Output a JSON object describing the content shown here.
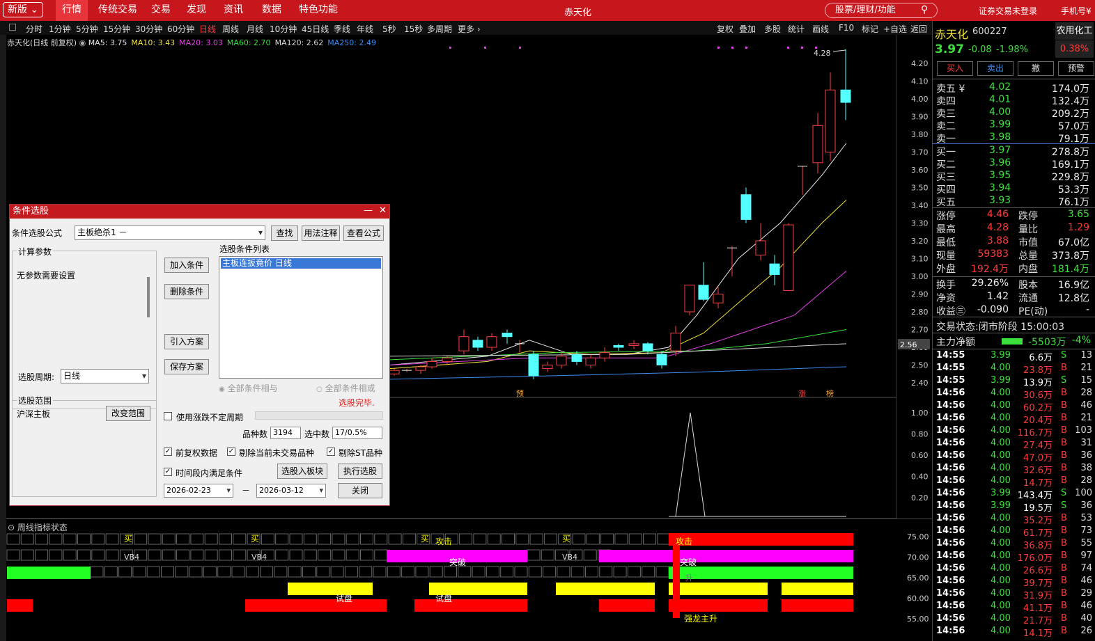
{
  "topbar": {
    "version": "新版",
    "nav": [
      "行情",
      "传统交易",
      "交易",
      "发现",
      "资讯",
      "数据",
      "特色功能"
    ],
    "active": 0,
    "app_title": "赤天化",
    "search_placeholder": "股票/理财/功能",
    "right_links": [
      "证券交易未登录",
      "手机号¥"
    ]
  },
  "timeframes": {
    "items": [
      "分时",
      "1分钟",
      "5分钟",
      "15分钟",
      "30分钟",
      "60分钟",
      "日线",
      "周线",
      "月线",
      "10分钟",
      "45日线",
      "季线",
      "年线",
      "5秒",
      "15秒",
      "多周期",
      "更多"
    ],
    "active": 6
  },
  "tools": [
    "复权",
    "叠加",
    "多股",
    "统计",
    "画线",
    "F10",
    "标记",
    "+自选",
    "返回"
  ],
  "ma_bar": {
    "title": "赤天化(日线 前复权)",
    "items": [
      {
        "label": "MA5: 3.75",
        "color": "#e8e8e8"
      },
      {
        "label": "MA10: 3.43",
        "color": "#f2e33b"
      },
      {
        "label": "MA20: 3.03",
        "color": "#e040e0"
      },
      {
        "label": "MA60: 2.70",
        "color": "#3ce03c"
      },
      {
        "label": "MA120: 2.62",
        "color": "#d8d8d8"
      },
      {
        "label": "MA250: 2.49",
        "color": "#3c8cf0"
      }
    ]
  },
  "price_axis": [
    "4.20",
    "4.10",
    "4.00",
    "3.90",
    "3.80",
    "3.70",
    "3.60",
    "3.50",
    "3.40",
    "3.30",
    "3.20",
    "3.10",
    "3.00",
    "2.90",
    "2.80",
    "2.70",
    "2.60",
    "2.50",
    "2.40"
  ],
  "price_label": "2.56",
  "high_label": "4.28",
  "markers": {
    "yu": "预",
    "zhang": "涨",
    "bang": "榜"
  },
  "indicator_axis": [
    "1.00",
    "0.80",
    "0.60",
    "0.40",
    "0.20"
  ],
  "bottom_axis": [
    "75.00",
    "70.00",
    "65.00",
    "60.00",
    "55.00"
  ],
  "bottom_title": "周线指标状态",
  "bottom_labels": {
    "buy": "买",
    "attack": "攻击",
    "vb4": "VB4",
    "breakout": "突破",
    "test": "试盘",
    "rise": "升",
    "dragon": "强龙主升",
    "attack2": "攻击",
    "breakout2": "突破",
    "test2": "试盘"
  },
  "quote": {
    "name": "赤天化",
    "code": "600227",
    "price": "3.97",
    "change": "-0.08",
    "pct": "-1.98%",
    "related": "农用化工",
    "related_pct": "0.38%",
    "buttons": [
      "买入",
      "卖出",
      "撤",
      "预警"
    ]
  },
  "asks": [
    {
      "label": "卖五",
      "price": "4.02",
      "vol": "174.0万",
      "yen": "¥"
    },
    {
      "label": "卖四",
      "price": "4.01",
      "vol": "132.4万"
    },
    {
      "label": "卖三",
      "price": "4.00",
      "vol": "209.2万"
    },
    {
      "label": "卖二",
      "price": "3.99",
      "vol": "57.0万"
    },
    {
      "label": "卖一",
      "price": "3.98",
      "vol": "79.1万"
    }
  ],
  "bids": [
    {
      "label": "买一",
      "price": "3.97",
      "vol": "278.8万"
    },
    {
      "label": "买二",
      "price": "3.96",
      "vol": "169.1万"
    },
    {
      "label": "买三",
      "price": "3.95",
      "vol": "229.8万"
    },
    {
      "label": "买四",
      "price": "3.94",
      "vol": "53.3万"
    },
    {
      "label": "买五",
      "price": "3.93",
      "vol": "76.1万"
    }
  ],
  "stats": [
    {
      "l1": "涨停",
      "v1": "4.46",
      "c1": "#ff3b3b",
      "l2": "跌停",
      "v2": "3.65",
      "c2": "#3ce03c"
    },
    {
      "l1": "最高",
      "v1": "4.28",
      "c1": "#ff3b3b",
      "l2": "量比",
      "v2": "1.29",
      "c2": "#ff3b3b"
    },
    {
      "l1": "最低",
      "v1": "3.88",
      "c1": "#ff3b3b",
      "l2": "市值",
      "v2": "67.0亿",
      "c2": "#eee"
    },
    {
      "l1": "现量",
      "v1": "59383",
      "c1": "#ff3b3b",
      "l2": "总量",
      "v2": "373.8万",
      "c2": "#eee"
    },
    {
      "l1": "外盘",
      "v1": "192.4万",
      "c1": "#ff3b3b",
      "l2": "内盘",
      "v2": "181.4万",
      "c2": "#3ce03c"
    },
    {
      "l1": "换手",
      "v1": "29.26%",
      "c1": "#eee",
      "l2": "股本",
      "v2": "16.9亿",
      "c2": "#eee"
    },
    {
      "l1": "净资",
      "v1": "1.42",
      "c1": "#eee",
      "l2": "流通",
      "v2": "12.8亿",
      "c2": "#eee"
    },
    {
      "l1": "收益㊂",
      "v1": "-0.090",
      "c1": "#eee",
      "l2": "PE(动)",
      "v2": "-",
      "c2": "#eee"
    }
  ],
  "trade_status": {
    "label": "交易状态:",
    "phase": "闭市阶段",
    "time": "15:00:03"
  },
  "main_flow": {
    "label": "主力净额",
    "value": "-5503万",
    "pct": "-4%"
  },
  "ticks": [
    {
      "t": "14:55",
      "p": "3.99",
      "v": "6.6万",
      "s": "S",
      "n": "13"
    },
    {
      "t": "14:55",
      "p": "4.00",
      "v": "23.8万",
      "s": "B",
      "n": "21"
    },
    {
      "t": "14:55",
      "p": "3.99",
      "v": "13.9万",
      "s": "S",
      "n": "15"
    },
    {
      "t": "14:56",
      "p": "4.00",
      "v": "30.6万",
      "s": "B",
      "n": "28"
    },
    {
      "t": "14:56",
      "p": "4.00",
      "v": "60.2万",
      "s": "B",
      "n": "46"
    },
    {
      "t": "14:56",
      "p": "4.00",
      "v": "20.4万",
      "s": "B",
      "n": "21"
    },
    {
      "t": "14:56",
      "p": "4.00",
      "v": "116.7万",
      "s": "B",
      "n": "103"
    },
    {
      "t": "14:56",
      "p": "4.00",
      "v": "27.4万",
      "s": "B",
      "n": "31"
    },
    {
      "t": "14:56",
      "p": "4.00",
      "v": "47.0万",
      "s": "B",
      "n": "36"
    },
    {
      "t": "14:56",
      "p": "4.00",
      "v": "32.6万",
      "s": "B",
      "n": "38"
    },
    {
      "t": "14:56",
      "p": "4.00",
      "v": "14.7万",
      "s": "B",
      "n": "28"
    },
    {
      "t": "14:56",
      "p": "3.99",
      "v": "143.4万",
      "s": "S",
      "n": "100"
    },
    {
      "t": "14:56",
      "p": "3.99",
      "v": "19.5万",
      "s": "S",
      "n": "36"
    },
    {
      "t": "14:56",
      "p": "4.00",
      "v": "35.2万",
      "s": "B",
      "n": "53"
    },
    {
      "t": "14:56",
      "p": "4.00",
      "v": "61.7万",
      "s": "B",
      "n": "73"
    },
    {
      "t": "14:56",
      "p": "4.00",
      "v": "36.8万",
      "s": "B",
      "n": "55"
    },
    {
      "t": "14:56",
      "p": "4.00",
      "v": "176.0万",
      "s": "B",
      "n": "97"
    },
    {
      "t": "14:56",
      "p": "4.00",
      "v": "26.6万",
      "s": "B",
      "n": "74"
    },
    {
      "t": "14:56",
      "p": "4.00",
      "v": "39.7万",
      "s": "B",
      "n": "46"
    },
    {
      "t": "14:56",
      "p": "4.00",
      "v": "31.9万",
      "s": "B",
      "n": "29"
    },
    {
      "t": "14:56",
      "p": "4.00",
      "v": "41.1万",
      "s": "B",
      "n": "46"
    },
    {
      "t": "14:56",
      "p": "4.00",
      "v": "21.7万",
      "s": "B",
      "n": "40"
    },
    {
      "t": "14:56",
      "p": "4.00",
      "v": "14.1万",
      "s": "B",
      "n": "26"
    }
  ],
  "dialog": {
    "title": "条件选股",
    "formula_label": "条件选股公式",
    "formula_value": "主板绝杀1  －",
    "btn_find": "查找",
    "btn_help": "用法注释",
    "btn_view": "查看公式",
    "params_group": "计算参数",
    "params_text": "无参数需要设置",
    "period_label": "选股周期:",
    "period_value": "日线",
    "btn_add": "加入条件",
    "btn_del": "删除条件",
    "btn_import": "引入方案",
    "btn_save": "保存方案",
    "list_title": "选股条件列表",
    "list_items": [
      "主板连扳竟价  日线"
    ],
    "radio_and": "全部条件相与",
    "radio_or": "全部条件相或",
    "done": "选股完毕.",
    "scope_group": "选股范围",
    "scope_value": "沪深主板",
    "btn_scope": "改变范围",
    "chk_period": "使用涨跌不定周期",
    "count_label": "品种数",
    "count_value": "3194",
    "sel_label": "选中数",
    "sel_value": "17/0.5%",
    "chk_fq": "前复权数据",
    "chk_exclude": "剔除当前未交易品种",
    "chk_st": "剔除ST品种",
    "chk_time": "时间段内满足条件",
    "btn_toblock": "选股入板块",
    "btn_run": "执行选股",
    "date_from": "2026-02-23",
    "date_sep": "－",
    "date_to": "2026-03-12",
    "btn_close": "关闭"
  }
}
